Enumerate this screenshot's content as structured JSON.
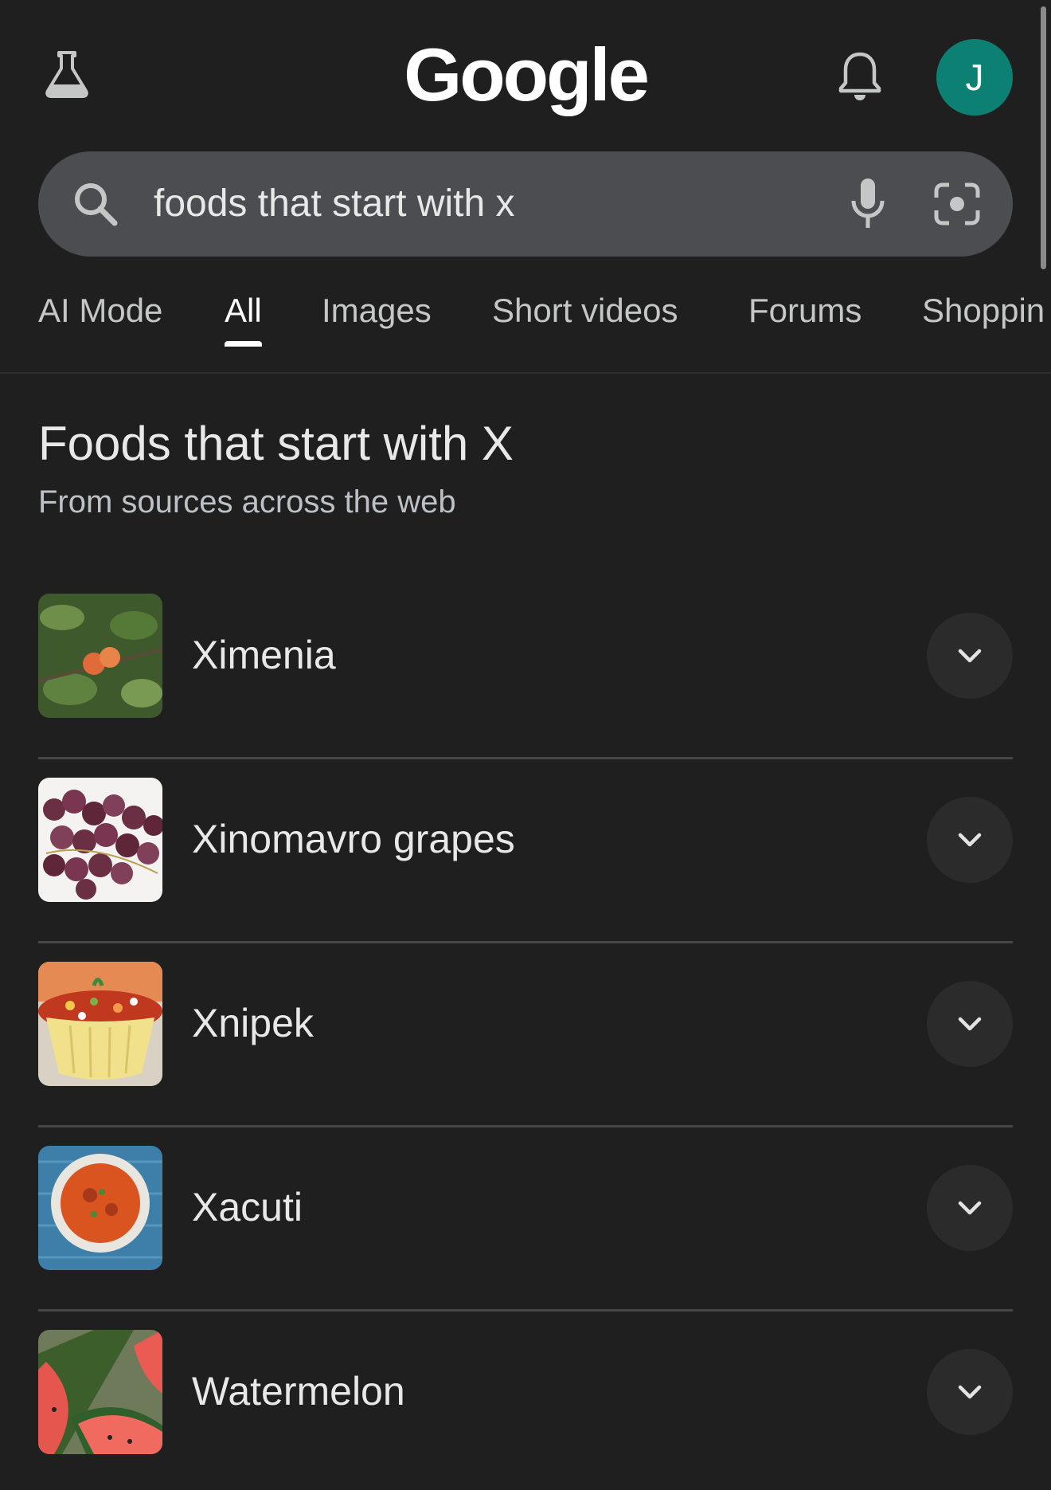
{
  "header": {
    "logo_text": "Google",
    "avatar_initial": "J",
    "labs_icon": "flask-icon",
    "notification_icon": "bell-icon"
  },
  "search": {
    "query": "foods that start with x",
    "search_icon": "search-icon",
    "voice_icon": "mic-icon",
    "lens_icon": "camera-lens-icon"
  },
  "tabs": [
    {
      "label": "AI Mode",
      "active": false
    },
    {
      "label": "All",
      "active": true
    },
    {
      "label": "Images",
      "active": false
    },
    {
      "label": "Short videos",
      "active": false
    },
    {
      "label": "Forums",
      "active": false
    },
    {
      "label": "Shoppin",
      "active": false
    }
  ],
  "section": {
    "title": "Foods that start with X",
    "subtitle": "From sources across the web"
  },
  "items": [
    {
      "name": "Ximenia"
    },
    {
      "name": "Xinomavro grapes"
    },
    {
      "name": "Xnipek"
    },
    {
      "name": "Xacuti"
    },
    {
      "name": "Watermelon"
    }
  ],
  "colors": {
    "background": "#1f1f1f",
    "search_bar": "#4b4d50",
    "avatar": "#0b8073",
    "divider": "#444746"
  }
}
